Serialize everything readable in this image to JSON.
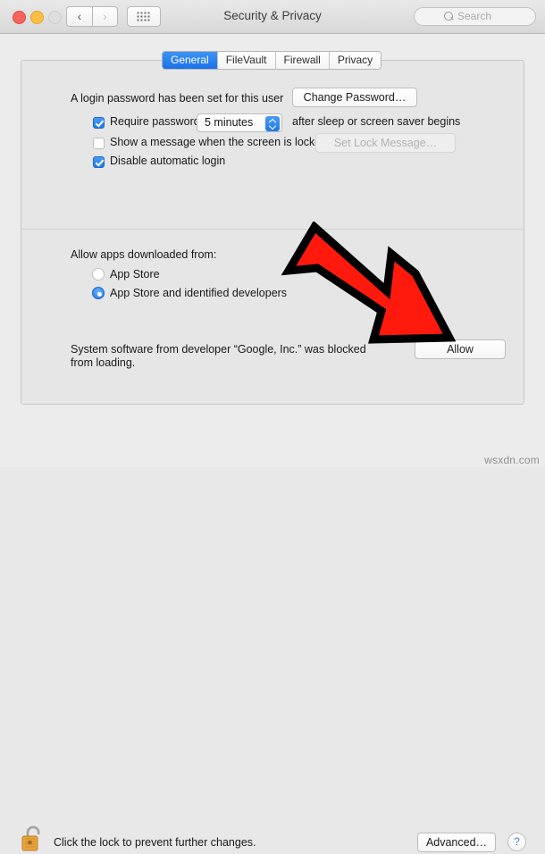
{
  "window": {
    "title": "Security & Privacy",
    "traffic_lights": [
      "close",
      "minimize",
      "zoom"
    ],
    "nav_back_glyph": "‹",
    "nav_forward_glyph": "›",
    "grid_icon": "grid-icon"
  },
  "search": {
    "placeholder": "Search",
    "value": ""
  },
  "tabs": [
    {
      "label": "General",
      "active": true
    },
    {
      "label": "FileVault",
      "active": false
    },
    {
      "label": "Firewall",
      "active": false
    },
    {
      "label": "Privacy",
      "active": false
    }
  ],
  "general": {
    "password_status": "A login password has been set for this user",
    "change_password_label": "Change Password…",
    "require_password": {
      "label": "Require password",
      "checked": true,
      "interval_value": "5 minutes",
      "suffix": "after sleep or screen saver begins"
    },
    "show_message": {
      "label": "Show a message when the screen is locked",
      "checked": false,
      "button_label": "Set Lock Message…",
      "button_disabled": true
    },
    "disable_auto_login": {
      "label": "Disable automatic login",
      "checked": true
    },
    "allow_apps_heading": "Allow apps downloaded from:",
    "allow_apps_options": [
      {
        "label": "App Store",
        "selected": false
      },
      {
        "label": "App Store and identified developers",
        "selected": true
      }
    ],
    "blocked_message_line1": "System software from developer “Google, Inc.” was blocked",
    "blocked_message_line2": "from loading.",
    "allow_button_label": "Allow"
  },
  "footer": {
    "lock_icon": "open-lock-icon",
    "lock_caption": "Click the lock to prevent further changes.",
    "advanced_label": "Advanced…",
    "help_label": "?"
  },
  "annotation": {
    "type": "red-arrow",
    "color": "#FF1A0D",
    "outline_color": "#000000",
    "points_at": "Allow"
  },
  "watermark": "wsxdn.com",
  "colors": {
    "accent_blue": "#1f78ea",
    "window_bg": "#ececec",
    "panel_bg": "#e6e6e6",
    "annotation_red": "#FF1A0D"
  }
}
